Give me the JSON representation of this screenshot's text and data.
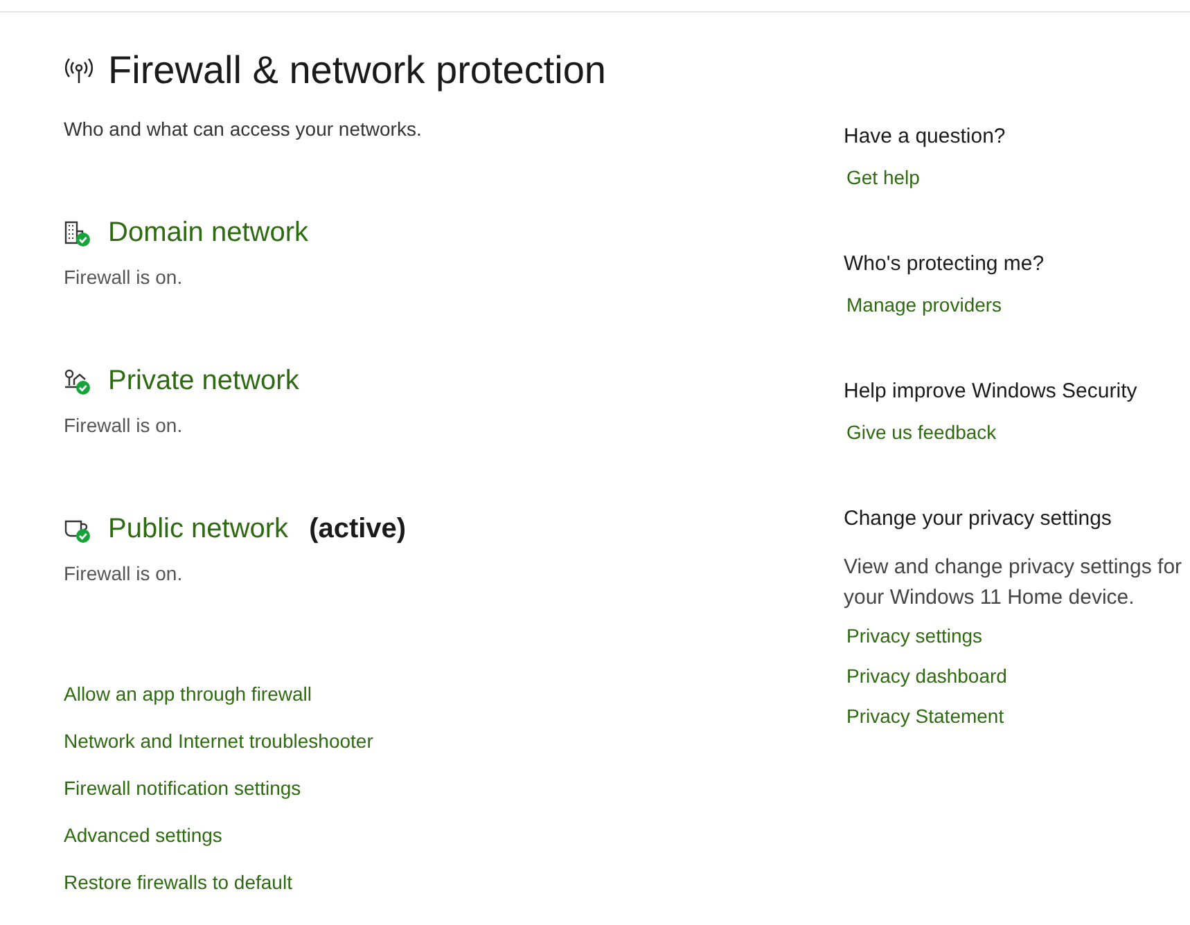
{
  "header": {
    "title": "Firewall & network protection",
    "subtitle": "Who and what can access your networks."
  },
  "networks": [
    {
      "kind": "domain",
      "name": "Domain network",
      "status": "Firewall is on."
    },
    {
      "kind": "private",
      "name": "Private network",
      "status": "Firewall is on."
    },
    {
      "kind": "public",
      "name": "Public network",
      "active_label": "(active)",
      "status": "Firewall is on."
    }
  ],
  "links": [
    "Allow an app through firewall",
    "Network and Internet troubleshooter",
    "Firewall notification settings",
    "Advanced settings",
    "Restore firewalls to default"
  ],
  "sidebar": [
    {
      "heading": "Have a question?",
      "links": [
        "Get help"
      ]
    },
    {
      "heading": "Who's protecting me?",
      "links": [
        "Manage providers"
      ]
    },
    {
      "heading": "Help improve Windows Security",
      "links": [
        "Give us feedback"
      ]
    },
    {
      "heading": "Change your privacy settings",
      "description": "View and change privacy settings for your Windows 11 Home device.",
      "links": [
        "Privacy settings",
        "Privacy dashboard",
        "Privacy Statement"
      ]
    }
  ]
}
